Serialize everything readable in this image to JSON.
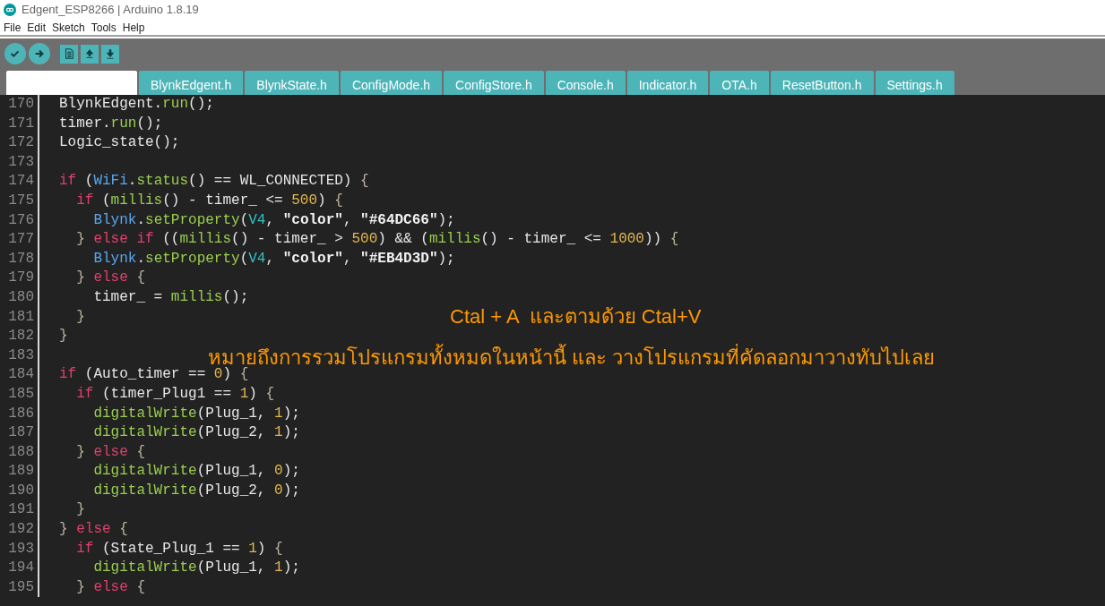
{
  "window": {
    "title": "Edgent_ESP8266 | Arduino 1.8.19"
  },
  "menu": [
    "File",
    "Edit",
    "Sketch",
    "Tools",
    "Help"
  ],
  "toolbar": [
    {
      "kind": "verify"
    },
    {
      "kind": "upload"
    },
    {
      "kind": "new"
    },
    {
      "kind": "open"
    },
    {
      "kind": "save"
    }
  ],
  "tabs": [
    {
      "selected": true
    },
    {
      "label": "BlynkEdgent.h",
      "selected": false
    },
    {
      "label": "BlynkState.h",
      "selected": false
    },
    {
      "label": "ConfigMode.h",
      "selected": false
    },
    {
      "label": "ConfigStore.h",
      "selected": false
    },
    {
      "label": "Console.h",
      "selected": false
    },
    {
      "label": "Indicator.h",
      "selected": false
    },
    {
      "label": "OTA.h",
      "selected": false
    },
    {
      "label": "ResetButton.h",
      "selected": false
    },
    {
      "label": "Settings.h",
      "selected": false
    }
  ],
  "code_lines": [
    {
      "number": "170",
      "tokens": [
        {
          "text": "BlynkEdgent.",
          "kind": "plain"
        },
        {
          "text": "run",
          "kind": "fn"
        },
        {
          "text": "();",
          "kind": "plain"
        }
      ]
    },
    {
      "number": "171",
      "tokens": [
        {
          "text": "timer.",
          "kind": "plain"
        },
        {
          "text": "run",
          "kind": "fn"
        },
        {
          "text": "();",
          "kind": "plain"
        }
      ]
    },
    {
      "number": "172",
      "tokens": [
        {
          "text": "Logic_state();",
          "kind": "plain"
        }
      ]
    },
    {
      "number": "173"
    },
    {
      "number": "174",
      "tokens": [
        {
          "text": "if",
          "kind": "kw"
        },
        {
          "text": " (",
          "kind": "plain"
        },
        {
          "text": "WiFi",
          "kind": "cls"
        },
        {
          "text": ".",
          "kind": "plain"
        },
        {
          "text": "status",
          "kind": "fn"
        },
        {
          "text": "() == WL_CONNECTED) ",
          "kind": "plain"
        },
        {
          "text": "{",
          "kind": "brace"
        }
      ]
    },
    {
      "number": "175",
      "tokens": [
        {
          "text": "  if",
          "kind": "kw"
        },
        {
          "text": " (",
          "kind": "plain"
        },
        {
          "text": "millis",
          "kind": "fn"
        },
        {
          "text": "() - timer_ <= ",
          "kind": "plain"
        },
        {
          "text": "500",
          "kind": "num"
        },
        {
          "text": ") ",
          "kind": "plain"
        },
        {
          "text": "{",
          "kind": "brace"
        }
      ]
    },
    {
      "number": "176",
      "tokens": [
        {
          "text": "    Blynk",
          "kind": "cls"
        },
        {
          "text": ".",
          "kind": "plain"
        },
        {
          "text": "setProperty",
          "kind": "fn"
        },
        {
          "text": "(",
          "kind": "plain"
        },
        {
          "text": "V4",
          "kind": "const"
        },
        {
          "text": ", ",
          "kind": "plain"
        },
        {
          "text": "\"color\"",
          "kind": "str"
        },
        {
          "text": ", ",
          "kind": "plain"
        },
        {
          "text": "\"#64DC66\"",
          "kind": "str"
        },
        {
          "text": ");",
          "kind": "plain"
        }
      ]
    },
    {
      "number": "177",
      "tokens": [
        {
          "text": "  } ",
          "kind": "brace"
        },
        {
          "text": "else if",
          "kind": "kw"
        },
        {
          "text": " ((",
          "kind": "plain"
        },
        {
          "text": "millis",
          "kind": "fn"
        },
        {
          "text": "() - timer_ > ",
          "kind": "plain"
        },
        {
          "text": "500",
          "kind": "num"
        },
        {
          "text": ") && (",
          "kind": "plain"
        },
        {
          "text": "millis",
          "kind": "fn"
        },
        {
          "text": "() - timer_ <= ",
          "kind": "plain"
        },
        {
          "text": "1000",
          "kind": "num"
        },
        {
          "text": ")) ",
          "kind": "plain"
        },
        {
          "text": "{",
          "kind": "brace"
        }
      ]
    },
    {
      "number": "178",
      "tokens": [
        {
          "text": "    Blynk",
          "kind": "cls"
        },
        {
          "text": ".",
          "kind": "plain"
        },
        {
          "text": "setProperty",
          "kind": "fn"
        },
        {
          "text": "(",
          "kind": "plain"
        },
        {
          "text": "V4",
          "kind": "const"
        },
        {
          "text": ", ",
          "kind": "plain"
        },
        {
          "text": "\"color\"",
          "kind": "str"
        },
        {
          "text": ", ",
          "kind": "plain"
        },
        {
          "text": "\"#EB4D3D\"",
          "kind": "str"
        },
        {
          "text": ");",
          "kind": "plain"
        }
      ]
    },
    {
      "number": "179",
      "tokens": [
        {
          "text": "  } ",
          "kind": "brace"
        },
        {
          "text": "else ",
          "kind": "kw"
        },
        {
          "text": "{",
          "kind": "brace"
        }
      ]
    },
    {
      "number": "180",
      "tokens": [
        {
          "text": "    timer_ = ",
          "kind": "plain"
        },
        {
          "text": "millis",
          "kind": "fn"
        },
        {
          "text": "();",
          "kind": "plain"
        }
      ]
    },
    {
      "number": "181",
      "tokens": [
        {
          "text": "  }",
          "kind": "brace"
        }
      ]
    },
    {
      "number": "182",
      "tokens": [
        {
          "text": "}",
          "kind": "brace"
        }
      ]
    },
    {
      "number": "183"
    },
    {
      "number": "184",
      "tokens": [
        {
          "text": "if",
          "kind": "kw"
        },
        {
          "text": " (Auto_timer == ",
          "kind": "plain"
        },
        {
          "text": "0",
          "kind": "num"
        },
        {
          "text": ") ",
          "kind": "plain"
        },
        {
          "text": "{",
          "kind": "brace"
        }
      ]
    },
    {
      "number": "185",
      "tokens": [
        {
          "text": "  if",
          "kind": "kw"
        },
        {
          "text": " (timer_Plug1 == ",
          "kind": "plain"
        },
        {
          "text": "1",
          "kind": "num"
        },
        {
          "text": ") ",
          "kind": "plain"
        },
        {
          "text": "{",
          "kind": "brace"
        }
      ]
    },
    {
      "number": "186",
      "tokens": [
        {
          "text": "    digitalWrite",
          "kind": "fn"
        },
        {
          "text": "(Plug_1, ",
          "kind": "plain"
        },
        {
          "text": "1",
          "kind": "num"
        },
        {
          "text": ");",
          "kind": "plain"
        }
      ]
    },
    {
      "number": "187",
      "tokens": [
        {
          "text": "    digitalWrite",
          "kind": "fn"
        },
        {
          "text": "(Plug_2, ",
          "kind": "plain"
        },
        {
          "text": "1",
          "kind": "num"
        },
        {
          "text": ");",
          "kind": "plain"
        }
      ]
    },
    {
      "number": "188",
      "tokens": [
        {
          "text": "  } ",
          "kind": "brace"
        },
        {
          "text": "else ",
          "kind": "kw"
        },
        {
          "text": "{",
          "kind": "brace"
        }
      ]
    },
    {
      "number": "189",
      "tokens": [
        {
          "text": "    digitalWrite",
          "kind": "fn"
        },
        {
          "text": "(Plug_1, ",
          "kind": "plain"
        },
        {
          "text": "0",
          "kind": "num"
        },
        {
          "text": ");",
          "kind": "plain"
        }
      ]
    },
    {
      "number": "190",
      "tokens": [
        {
          "text": "    digitalWrite",
          "kind": "fn"
        },
        {
          "text": "(Plug_2, ",
          "kind": "plain"
        },
        {
          "text": "0",
          "kind": "num"
        },
        {
          "text": ");",
          "kind": "plain"
        }
      ]
    },
    {
      "number": "191",
      "tokens": [
        {
          "text": "  }",
          "kind": "brace"
        }
      ]
    },
    {
      "number": "192",
      "tokens": [
        {
          "text": "} ",
          "kind": "brace"
        },
        {
          "text": "else ",
          "kind": "kw"
        },
        {
          "text": "{",
          "kind": "brace"
        }
      ]
    },
    {
      "number": "193",
      "tokens": [
        {
          "text": "  if",
          "kind": "kw"
        },
        {
          "text": " (State_Plug_1 == ",
          "kind": "plain"
        },
        {
          "text": "1",
          "kind": "num"
        },
        {
          "text": ") ",
          "kind": "plain"
        },
        {
          "text": "{",
          "kind": "brace"
        }
      ]
    },
    {
      "number": "194",
      "tokens": [
        {
          "text": "    digitalWrite",
          "kind": "fn"
        },
        {
          "text": "(Plug_1, ",
          "kind": "plain"
        },
        {
          "text": "1",
          "kind": "num"
        },
        {
          "text": ");",
          "kind": "plain"
        }
      ]
    },
    {
      "number": "195",
      "tokens": [
        {
          "text": "  } ",
          "kind": "brace"
        },
        {
          "text": "else ",
          "kind": "kw"
        },
        {
          "text": "{",
          "kind": "brace"
        }
      ]
    }
  ],
  "annotations": [
    "Ctal + A  และตามด้วย Ctal+V",
    "หมายถึงการรวมโปรแกรมทั้งหมดในหน้านี้ และ วางโปรแกรมที่คัดลอกมาวางทับไปเลย"
  ]
}
